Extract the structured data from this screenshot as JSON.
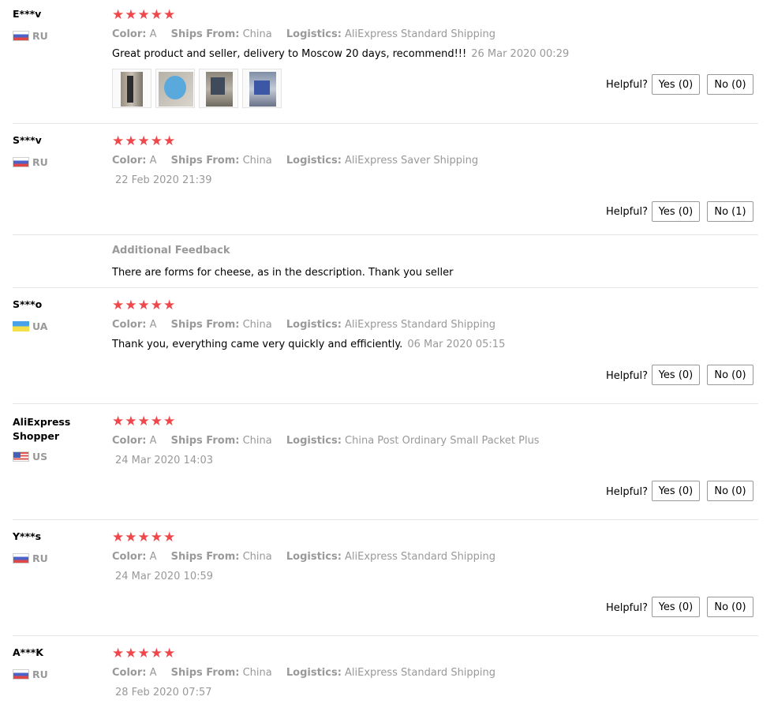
{
  "labels": {
    "color": "Color:",
    "ships_from": "Ships From:",
    "logistics": "Logistics:",
    "helpful": "Helpful?",
    "additional_feedback": "Additional Feedback"
  },
  "reviews": [
    {
      "name": "E***v",
      "country": "RU",
      "stars": "★★★★★",
      "color": "A",
      "ships_from": "China",
      "logistics": "AliExpress Standard Shipping",
      "text": "Great product and seller, delivery to Moscow 20 days, recommend!!!",
      "date": "26 Mar 2020 00:29",
      "yes": "Yes (0)",
      "no": "No (0)",
      "photos": 4
    },
    {
      "name": "S***v",
      "country": "RU",
      "stars": "★★★★★",
      "color": "A",
      "ships_from": "China",
      "logistics": "AliExpress Saver Shipping",
      "text": "",
      "date": "22 Feb 2020 21:39",
      "yes": "Yes (0)",
      "no": "No (1)",
      "additional": "There are forms for cheese, as in the description. Thank you seller"
    },
    {
      "name": "S***o",
      "country": "UA",
      "stars": "★★★★★",
      "color": "A",
      "ships_from": "China",
      "logistics": "AliExpress Standard Shipping",
      "text": "Thank you, everything came very quickly and efficiently.",
      "date": "06 Mar 2020 05:15",
      "yes": "Yes (0)",
      "no": "No (0)"
    },
    {
      "name": "AliExpress Shopper",
      "country": "US",
      "stars": "★★★★★",
      "color": "A",
      "ships_from": "China",
      "logistics": "China Post Ordinary Small Packet Plus",
      "text": "",
      "date": "24 Mar 2020 14:03",
      "yes": "Yes (0)",
      "no": "No (0)"
    },
    {
      "name": "Y***s",
      "country": "RU",
      "stars": "★★★★★",
      "color": "A",
      "ships_from": "China",
      "logistics": "AliExpress Standard Shipping",
      "text": "",
      "date": "24 Mar 2020 10:59",
      "yes": "Yes (0)",
      "no": "No (0)"
    },
    {
      "name": "A***K",
      "country": "RU",
      "stars": "★★★★★",
      "color": "A",
      "ships_from": "China",
      "logistics": "AliExpress Standard Shipping",
      "text": "",
      "date": "28 Feb 2020 07:57"
    }
  ],
  "colors": {
    "star": "#f0474b",
    "muted": "#999999",
    "divider": "#e5e5e5"
  }
}
